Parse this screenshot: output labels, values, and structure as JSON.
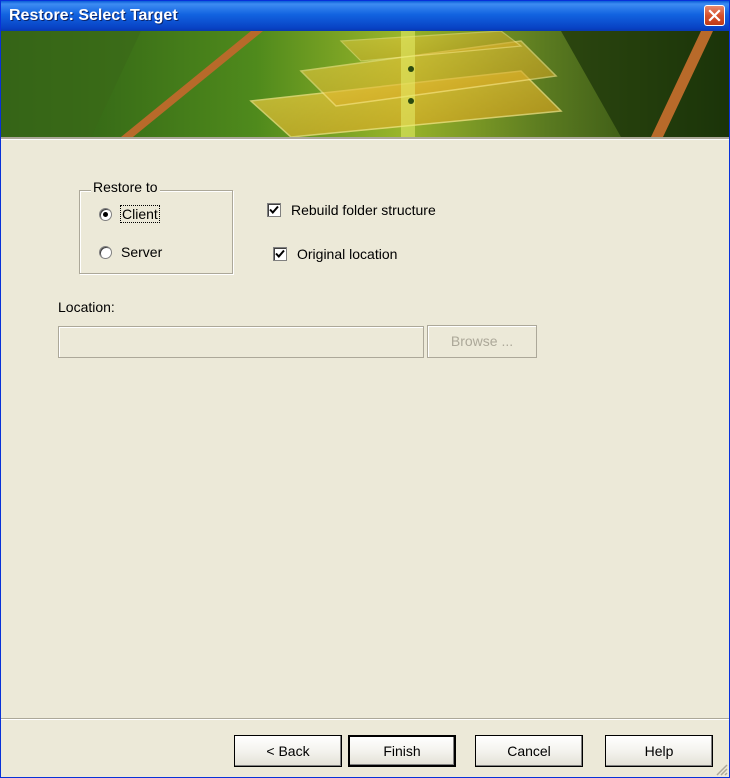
{
  "window": {
    "title": "Restore: Select Target"
  },
  "restore_to": {
    "legend": "Restore to",
    "options": [
      {
        "label": "Client",
        "selected": true
      },
      {
        "label": "Server",
        "selected": false
      }
    ]
  },
  "options": {
    "rebuild_folder_structure": {
      "label": "Rebuild folder structure",
      "checked": true
    },
    "original_location": {
      "label": "Original location",
      "checked": true
    }
  },
  "location": {
    "label": "Location:",
    "value": "",
    "browse_label": "Browse ..."
  },
  "buttons": {
    "back": "< Back",
    "finish": "Finish",
    "cancel": "Cancel",
    "help": "Help"
  },
  "colors": {
    "title_bar": "#0a5fd8",
    "dialog_background": "#ece9d8",
    "close_button": "#d6512c",
    "banner_accent": "#f0c020"
  },
  "icons": [
    "close-icon",
    "size-grip-icon"
  ]
}
